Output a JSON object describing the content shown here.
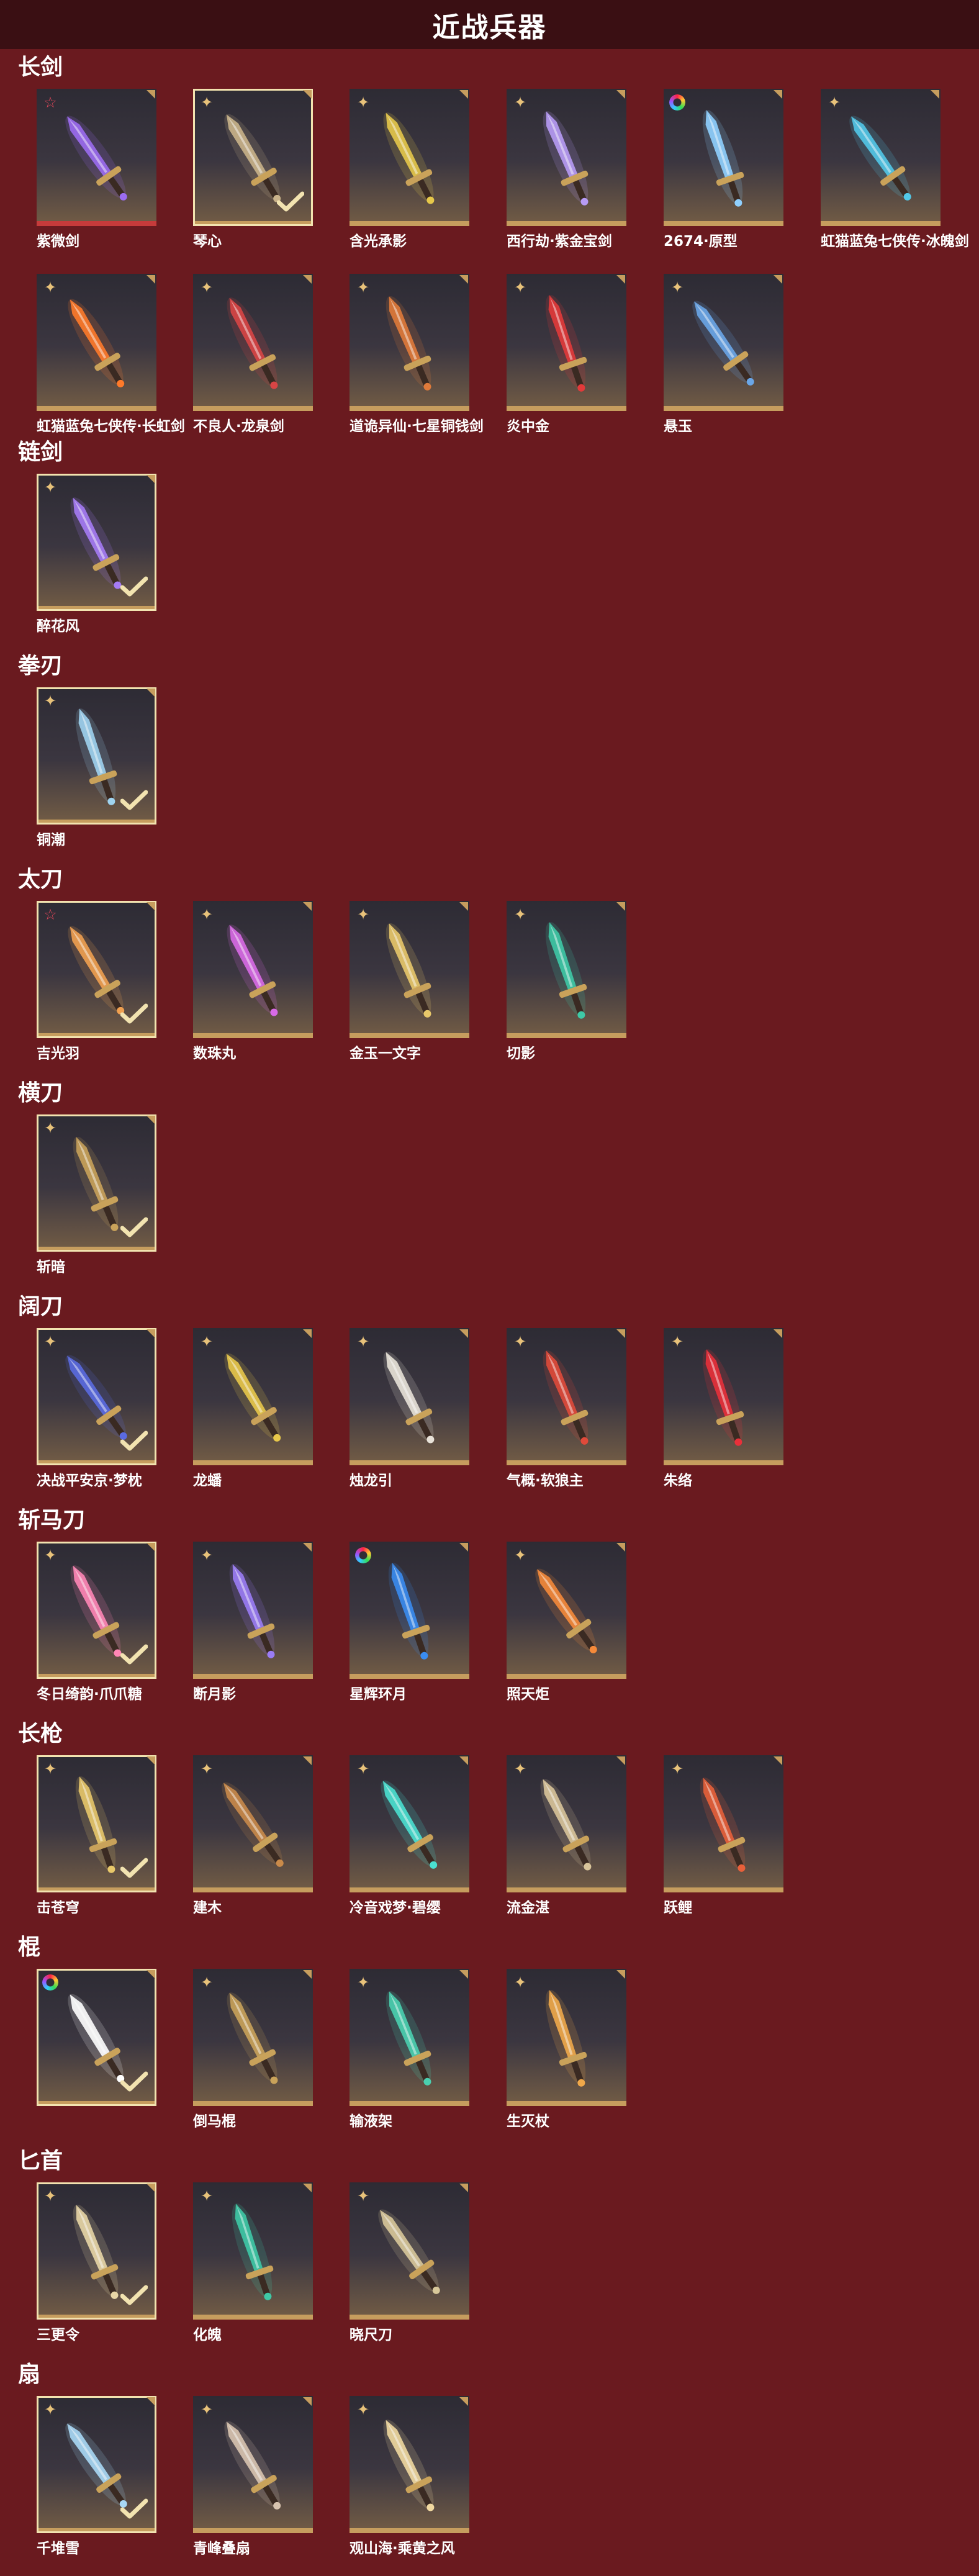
{
  "header": {
    "title": "近战兵器"
  },
  "colors": {
    "background": "#6a1a1f",
    "header_bg": "#3a0f13",
    "tile_border_gold": "#c69d5e",
    "tile_border_red": "#c63b3b"
  },
  "sections": [
    {
      "title": "长剑",
      "items": [
        {
          "name": "紫微剑",
          "badge": "red-star-icon",
          "owned": false,
          "accent": "#9b6cf0"
        },
        {
          "name": "琴心",
          "badge": "gold-star-icon",
          "owned": true,
          "accent": "#c9b28a"
        },
        {
          "name": "含光承影",
          "badge": "gold-star-icon",
          "owned": false,
          "accent": "#e6c84a"
        },
        {
          "name": "西行劫·紫金宝剑",
          "badge": "gold-star-icon",
          "owned": false,
          "accent": "#b79bf5"
        },
        {
          "name": "2674·原型",
          "badge": "rainbow-ring-icon",
          "owned": false,
          "accent": "#8fd0ff"
        },
        {
          "name": "虹猫蓝兔七侠传·冰魄剑",
          "badge": "gold-star-icon",
          "owned": false,
          "accent": "#52c8e8"
        },
        {
          "name": "虹猫蓝兔七侠传·长虹剑",
          "badge": "gold-star-icon",
          "owned": false,
          "accent": "#ff7a2a"
        },
        {
          "name": "不良人·龙泉剑",
          "badge": "gold-star-icon",
          "owned": false,
          "accent": "#d84545"
        },
        {
          "name": "道诡异仙·七星铜钱剑",
          "badge": "gold-star-icon",
          "owned": false,
          "accent": "#e07a3a"
        },
        {
          "name": "炎中金",
          "badge": "gold-star-icon",
          "owned": false,
          "accent": "#e23a3a"
        },
        {
          "name": "悬玉",
          "badge": "gold-star-icon",
          "owned": false,
          "accent": "#6aa6e8"
        }
      ]
    },
    {
      "title": "链剑",
      "items": [
        {
          "name": "醉花风",
          "badge": "gold-star-icon",
          "owned": true,
          "accent": "#a57bf5"
        }
      ]
    },
    {
      "title": "拳刃",
      "items": [
        {
          "name": "铜潮",
          "badge": "gold-star-icon",
          "owned": true,
          "accent": "#9fd3ef"
        }
      ]
    },
    {
      "title": "太刀",
      "items": [
        {
          "name": "吉光羽",
          "badge": "red-star-icon",
          "owned": true,
          "accent": "#f0a050"
        },
        {
          "name": "数珠丸",
          "badge": "gold-star-icon",
          "owned": false,
          "accent": "#d86ae6"
        },
        {
          "name": "金玉一文字",
          "badge": "gold-star-icon",
          "owned": false,
          "accent": "#e8c86a"
        },
        {
          "name": "切影",
          "badge": "gold-star-icon",
          "owned": false,
          "accent": "#3ec9a6"
        }
      ]
    },
    {
      "title": "横刀",
      "items": [
        {
          "name": "斩暗",
          "badge": "gold-star-icon",
          "owned": true,
          "accent": "#c9a25a"
        }
      ]
    },
    {
      "title": "阔刀",
      "items": [
        {
          "name": "决战平安京·梦枕",
          "badge": "gold-star-icon",
          "owned": true,
          "accent": "#5a6ae0"
        },
        {
          "name": "龙蟠",
          "badge": "gold-star-icon",
          "owned": false,
          "accent": "#e8c84a"
        },
        {
          "name": "烛龙引",
          "badge": "gold-star-icon",
          "owned": false,
          "accent": "#e8e2d8"
        },
        {
          "name": "气概·软狼主",
          "badge": "gold-star-icon",
          "owned": false,
          "accent": "#e04a3a"
        },
        {
          "name": "朱络",
          "badge": "gold-star-icon",
          "owned": false,
          "accent": "#e8303a"
        }
      ]
    },
    {
      "title": "斩马刀",
      "items": [
        {
          "name": "冬日绮韵·爪爪糖",
          "badge": "gold-star-icon",
          "owned": true,
          "accent": "#ff86b6"
        },
        {
          "name": "断月影",
          "badge": "gold-star-icon",
          "owned": false,
          "accent": "#9a7cf5"
        },
        {
          "name": "星辉环月",
          "badge": "rainbow-ring-icon",
          "owned": false,
          "accent": "#3a8cf0"
        },
        {
          "name": "照天炬",
          "badge": "gold-star-icon",
          "owned": false,
          "accent": "#f58a3a"
        }
      ]
    },
    {
      "title": "长枪",
      "items": [
        {
          "name": "击苍穹",
          "badge": "gold-star-icon",
          "owned": true,
          "accent": "#e8c86a"
        },
        {
          "name": "建木",
          "badge": "gold-star-icon",
          "owned": false,
          "accent": "#c98a4a"
        },
        {
          "name": "冷音戏梦·碧缨",
          "badge": "gold-star-icon",
          "owned": false,
          "accent": "#4ae0d0"
        },
        {
          "name": "流金湛",
          "badge": "gold-star-icon",
          "owned": false,
          "accent": "#d8c49a"
        },
        {
          "name": "跃鲤",
          "badge": "gold-star-icon",
          "owned": false,
          "accent": "#e8603a"
        }
      ]
    },
    {
      "title": "棍",
      "items": [
        {
          "name": "",
          "badge": "rainbow-ring-icon",
          "owned": true,
          "accent": "#ffffff"
        },
        {
          "name": "倒马棍",
          "badge": "gold-star-icon",
          "owned": false,
          "accent": "#c9a25a"
        },
        {
          "name": "输液架",
          "badge": "gold-star-icon",
          "owned": false,
          "accent": "#4ad0b0"
        },
        {
          "name": "生灭杖",
          "badge": "gold-star-icon",
          "owned": false,
          "accent": "#f0a84a"
        }
      ]
    },
    {
      "title": "匕首",
      "items": [
        {
          "name": "三更令",
          "badge": "gold-star-icon",
          "owned": true,
          "accent": "#e8d6a6"
        },
        {
          "name": "化魄",
          "badge": "gold-star-icon",
          "owned": false,
          "accent": "#3ec9a6"
        },
        {
          "name": "晓尺刀",
          "badge": "gold-star-icon",
          "owned": false,
          "accent": "#d8c89a"
        }
      ]
    },
    {
      "title": "扇",
      "items": [
        {
          "name": "千堆雪",
          "badge": "gold-star-icon",
          "owned": true,
          "accent": "#a8d8f5"
        },
        {
          "name": "青峰叠扇",
          "badge": "gold-star-icon",
          "owned": false,
          "accent": "#d8c4b0"
        },
        {
          "name": "观山海·乘黄之风",
          "badge": "gold-star-icon",
          "owned": false,
          "accent": "#f0d8a0"
        }
      ]
    }
  ]
}
